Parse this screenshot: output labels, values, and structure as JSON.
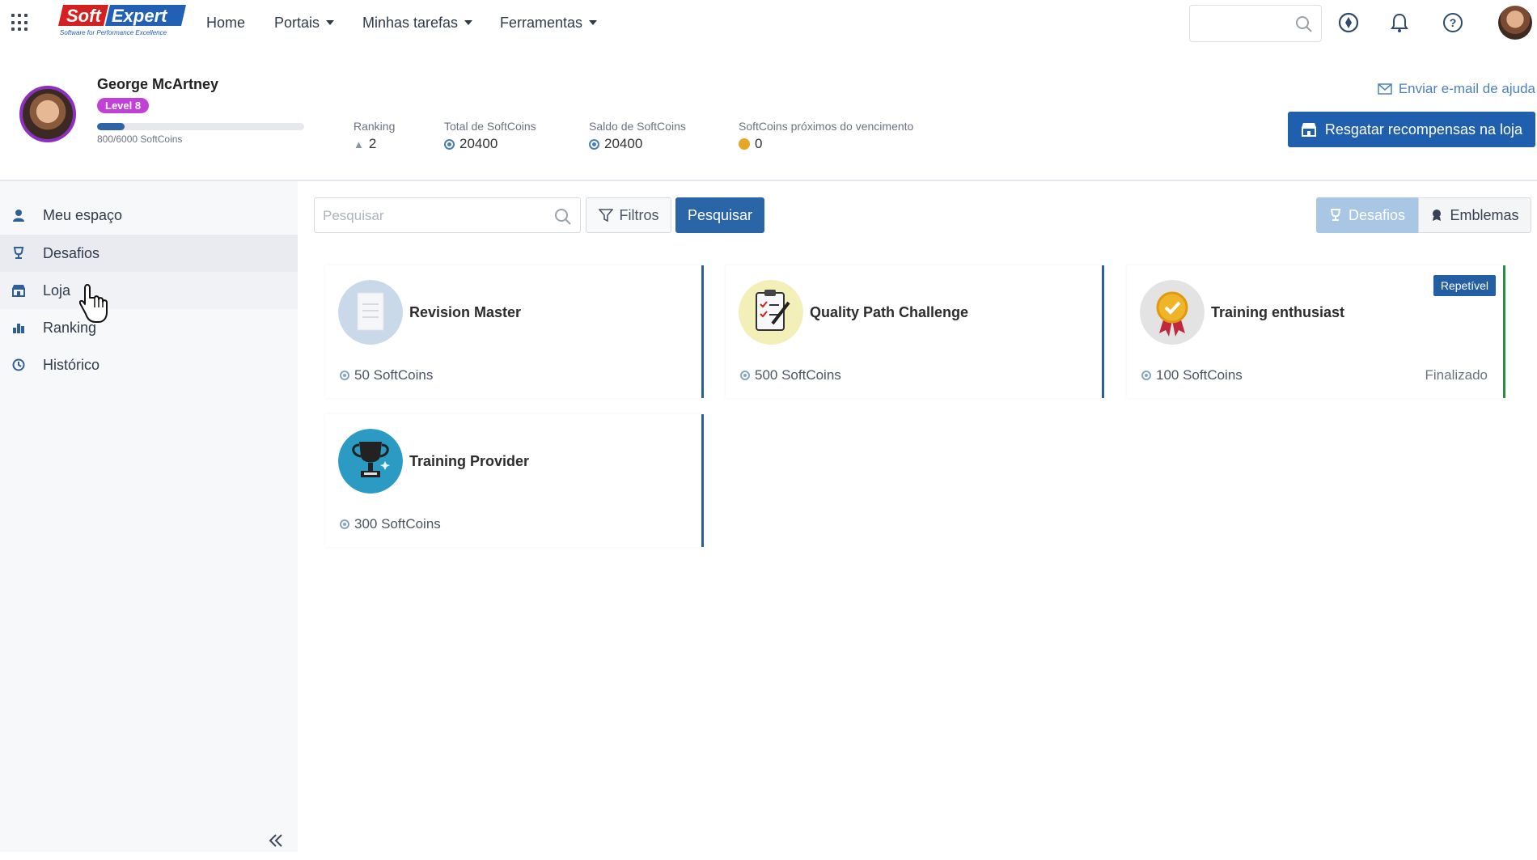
{
  "brand": {
    "logo_text_soft": "Soft",
    "logo_text_expert": "Expert",
    "logo_tagline": "Software for Performance Excellence"
  },
  "nav": {
    "home": "Home",
    "portals": "Portais",
    "tasks": "Minhas tarefas",
    "tools": "Ferramentas"
  },
  "profile": {
    "name": "George McArtney",
    "level": "Level 8",
    "progress_text": "800/6000 SoftCoins",
    "progress_fraction": 0.133,
    "stats": [
      {
        "label": "Ranking",
        "value": "2"
      },
      {
        "label": "Total de SoftCoins",
        "value": "20400"
      },
      {
        "label": "Saldo de SoftCoins",
        "value": "20400"
      },
      {
        "label": "SoftCoins próximos do vencimento",
        "value": "0"
      }
    ],
    "help_link": "Enviar e-mail de ajuda",
    "redeem_button": "Resgatar recompensas na loja"
  },
  "sidebar": {
    "items": [
      {
        "label": "Meu espaço",
        "icon": "user-icon"
      },
      {
        "label": "Desafios",
        "icon": "trophy-icon"
      },
      {
        "label": "Loja",
        "icon": "store-icon"
      },
      {
        "label": "Ranking",
        "icon": "ranking-icon"
      },
      {
        "label": "Histórico",
        "icon": "clock-icon"
      }
    ]
  },
  "toolbar": {
    "search_placeholder": "Pesquisar",
    "filters_label": "Filtros",
    "search_button": "Pesquisar",
    "toggle_challenges": "Desafios",
    "toggle_badges": "Emblemas"
  },
  "cards": [
    {
      "title": "Revision Master",
      "coins": "50 SoftCoins",
      "status": "",
      "tag": "",
      "icon": "document-icon"
    },
    {
      "title": "Quality Path Challenge",
      "coins": "500 SoftCoins",
      "status": "",
      "tag": "",
      "icon": "clipboard-icon"
    },
    {
      "title": "Training enthusiast",
      "coins": "100 SoftCoins",
      "status": "Finalizado",
      "tag": "Repetível",
      "icon": "medal-icon"
    },
    {
      "title": "Training Provider",
      "coins": "300 SoftCoins",
      "status": "",
      "tag": "",
      "icon": "trophy-icon"
    }
  ],
  "colors": {
    "primary": "#2a65a8",
    "level_badge": "#c040d8",
    "completed_bar": "#2f8a46"
  }
}
